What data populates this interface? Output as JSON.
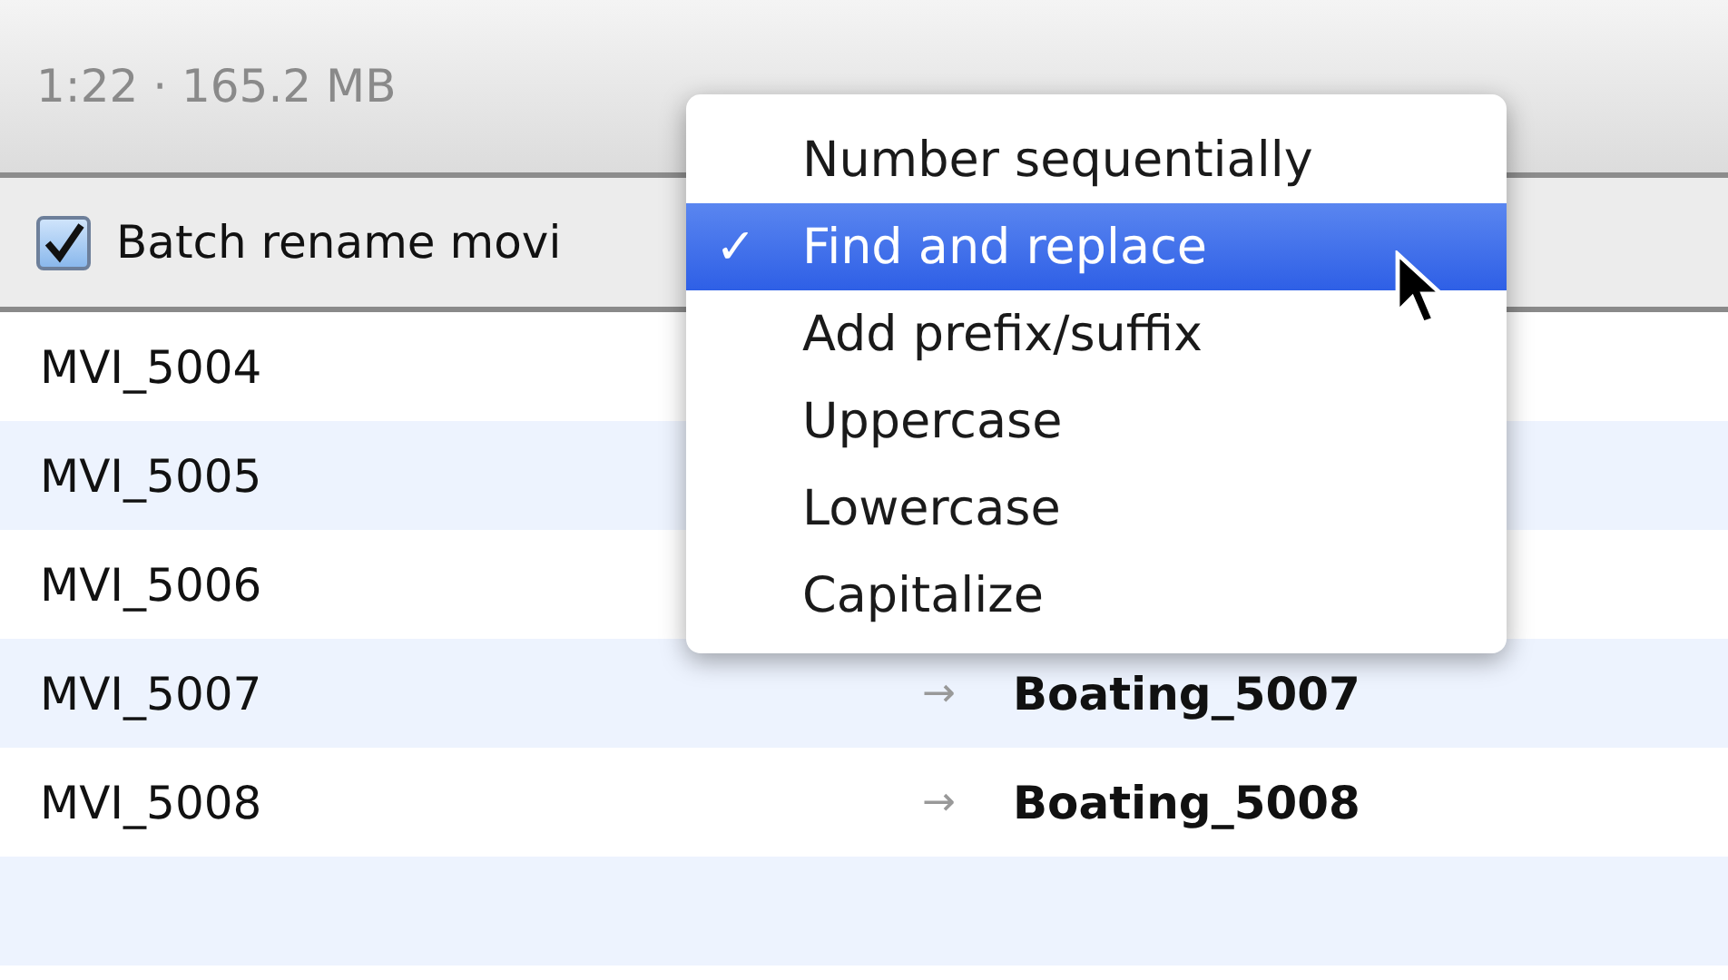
{
  "info": "1:22 · 165.2 MB",
  "batch": {
    "label": "Batch rename movi",
    "checked": true
  },
  "rows": [
    {
      "original": "MVI_5004"
    },
    {
      "original": "MVI_5005"
    },
    {
      "original": "MVI_5006"
    },
    {
      "original": "MVI_5007",
      "arrow": "→",
      "renamed": "Boating_5007"
    },
    {
      "original": "MVI_5008",
      "arrow": "→",
      "renamed": "Boating_5008"
    }
  ],
  "menu": {
    "check_mark": "✓",
    "items": [
      {
        "label": "Number sequentially",
        "selected": false
      },
      {
        "label": "Find and replace",
        "selected": true
      },
      {
        "label": "Add prefix/suffix",
        "selected": false
      },
      {
        "label": "Uppercase",
        "selected": false
      },
      {
        "label": "Lowercase",
        "selected": false
      },
      {
        "label": "Capitalize",
        "selected": false
      }
    ]
  }
}
